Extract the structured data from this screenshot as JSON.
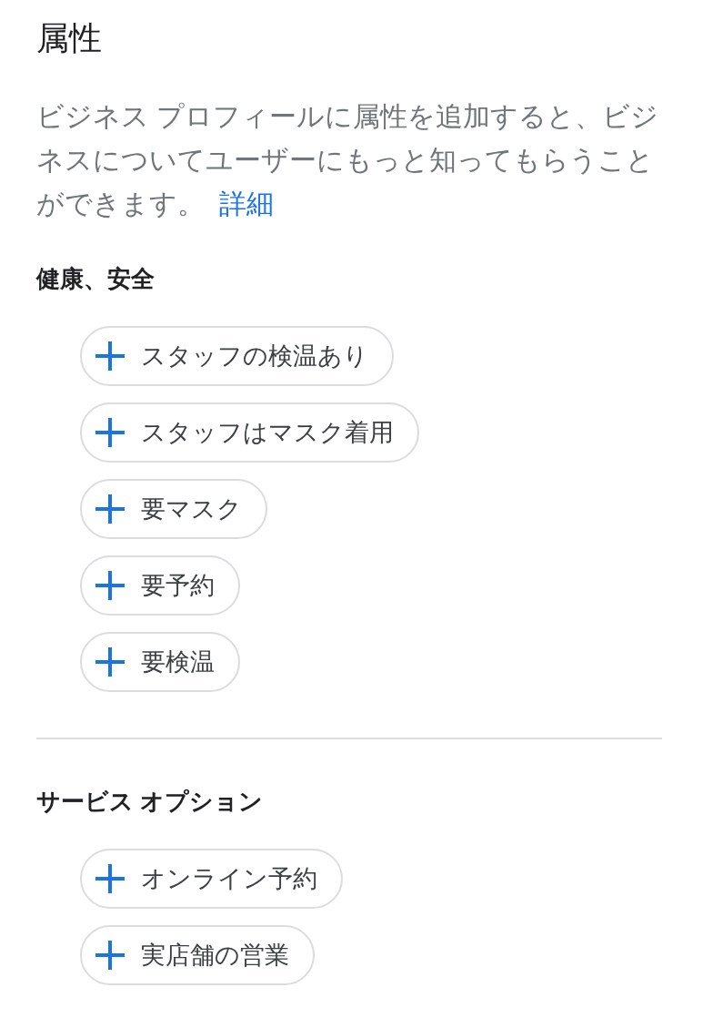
{
  "title": "属性",
  "description": {
    "text": "ビジネス プロフィールに属性を追加すると、ビジネスについてユーザーにもっと知ってもらうことができます。",
    "link": "詳細"
  },
  "sections": [
    {
      "heading": "健康、安全",
      "attributes": [
        "スタッフの検温あり",
        "スタッフはマスク着用",
        "要マスク",
        "要予約",
        "要検温"
      ]
    },
    {
      "heading": "サービス オプション",
      "attributes": [
        "オンライン予約",
        "実店舗の営業"
      ]
    }
  ]
}
